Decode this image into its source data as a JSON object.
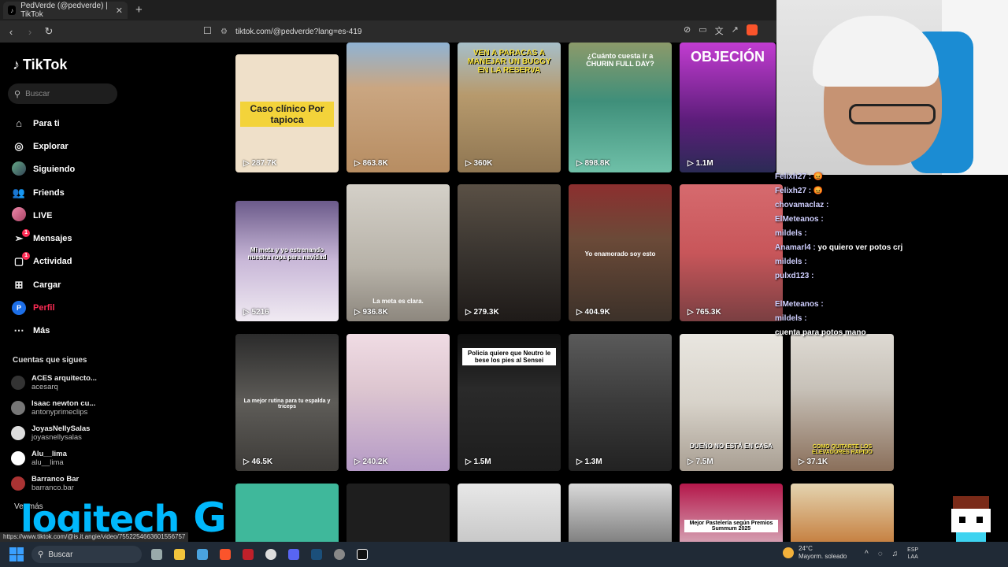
{
  "browser": {
    "tab_title": "PedVerde (@pedverde) | TikTok",
    "tab_close": "✕",
    "new_tab": "+",
    "url": "tiktok.com/@pedverde?lang=es-419",
    "status_url": "https://www.tiktok.com/@is.it.angie/video/7552254663601556757"
  },
  "sidebar": {
    "logo": "TikTok",
    "search_placeholder": "Buscar",
    "nav": [
      {
        "label": "Para ti",
        "icon": "home-icon"
      },
      {
        "label": "Explorar",
        "icon": "compass-icon"
      },
      {
        "label": "Siguiendo",
        "icon": "following-avatar-icon"
      },
      {
        "label": "Friends",
        "icon": "friends-icon"
      },
      {
        "label": "LIVE",
        "icon": "live-icon"
      },
      {
        "label": "Mensajes",
        "icon": "messages-icon",
        "badge": "1"
      },
      {
        "label": "Actividad",
        "icon": "activity-icon",
        "badge": "1"
      },
      {
        "label": "Cargar",
        "icon": "upload-icon"
      },
      {
        "label": "Perfil",
        "icon": "profile-avatar-icon",
        "active": true
      },
      {
        "label": "Más",
        "icon": "more-icon"
      }
    ],
    "following_title": "Cuentas que sigues",
    "following": [
      {
        "name": "ACES arquitecto...",
        "handle": "acesarq"
      },
      {
        "name": "Isaac newton cu...",
        "handle": "antonyprimeclips"
      },
      {
        "name": "JoyasNellySalas",
        "handle": "joyasnellysalas"
      },
      {
        "name": "Alu__lima",
        "handle": "alu__lima"
      },
      {
        "name": "Barranco Bar",
        "handle": "barranco.bar"
      }
    ],
    "ver_mas": "Ver más"
  },
  "grid": {
    "row1": [
      {
        "views": "287.7K",
        "caption": "Caso clínico Por tapioca",
        "color": "#efe0c9"
      },
      {
        "views": "863.8K",
        "caption": "",
        "color": "#caa681"
      },
      {
        "views": "360K",
        "caption": "VEN A PARACAS A MANEJAR UN BUGGY EN LA RESERVA",
        "color": "#b79a6d"
      },
      {
        "views": "898.8K",
        "caption": "¿Cuánto cuesta ir a CHURIN FULL DAY?",
        "color": "#3f8f7a"
      },
      {
        "views": "1.1M",
        "caption": "OBJECIÓN",
        "color": "#9a3db8"
      }
    ],
    "row2": [
      {
        "views": "5216",
        "caption": "Mi meta y yo estrenando nuestra ropa para navidad",
        "color": "#c9b8d8"
      },
      {
        "views": "936.8K",
        "caption": "La meta es clara.",
        "color": "#b7b2a8"
      },
      {
        "views": "279.3K",
        "caption": "",
        "color": "#3a3530"
      },
      {
        "views": "404.9K",
        "caption": "Yo enamorado soy esto",
        "color": "#6b4a38"
      },
      {
        "views": "765.3K",
        "caption": "",
        "color": "#c8565a"
      }
    ],
    "row3": [
      {
        "views": "46.5K",
        "caption": "La mejor rutina para tu espalda y triceps",
        "color": "#5e5c58"
      },
      {
        "views": "240.2K",
        "caption": "",
        "color": "#ddc6d0"
      },
      {
        "views": "1.5M",
        "caption": "Policía quiere que Neutro le bese los pies al Sensei",
        "color": "#1d1d1d"
      },
      {
        "views": "1.3M",
        "caption": "",
        "color": "#3b3b3b"
      },
      {
        "views": "7.5M",
        "caption": "DUEÑO NO ESTÁ EN CASA",
        "color": "#d8d3ca"
      },
      {
        "views": "37.1K",
        "caption": "COMO QUITARTE LOS ELEVADORES RAPIDO",
        "color": "#c7c1b8"
      }
    ],
    "row4": [
      {
        "caption": "",
        "color": "#3fb89b"
      },
      {
        "caption": "",
        "color": "#1e1e1e"
      },
      {
        "caption": "",
        "color": "#d9d9d9"
      },
      {
        "caption": "",
        "color": "#cfcfcf"
      },
      {
        "caption": "Mejor Pastelería según Premios Summum 2025",
        "color": "#b4174a"
      },
      {
        "caption": "",
        "color": "#c47b3a"
      }
    ]
  },
  "chat": [
    {
      "user": "Felixh27 :",
      "msg": "😡"
    },
    {
      "user": "Felixh27 :",
      "msg": "😡"
    },
    {
      "user": "chovamaclaz :",
      "msg": ""
    },
    {
      "user": "ElMeteanos :",
      "msg": ""
    },
    {
      "user": "mildels :",
      "msg": ""
    },
    {
      "user": "Anamarl4 :",
      "msg": "yo quiero ver potos crj"
    },
    {
      "user": "mildels :",
      "msg": ""
    },
    {
      "user": "pulxd123 :",
      "msg": ""
    },
    {
      "user": "",
      "msg": ""
    },
    {
      "user": "ElMeteanos :",
      "msg": ""
    },
    {
      "user": "mildels :",
      "msg": ""
    },
    {
      "user": "",
      "msg": "cuenta para potos mano"
    }
  ],
  "overlay": {
    "brand": "logitech",
    "brand_g": "G"
  },
  "taskbar": {
    "search": "Buscar",
    "temp": "24°C",
    "weather": "Mayorm. soleado",
    "lang1": "ESP",
    "lang2": "LAA"
  },
  "colors": {
    "accent": "#fe2c55",
    "logitech": "#00b8fc",
    "sidebar_bg": "#000000"
  }
}
